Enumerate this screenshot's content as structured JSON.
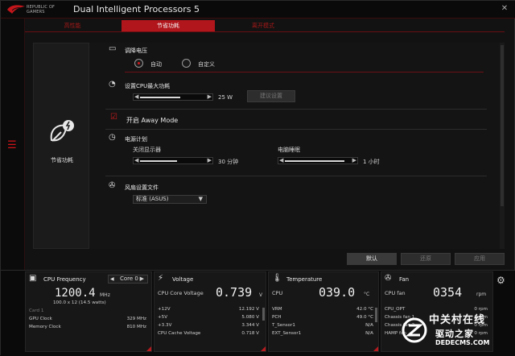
{
  "app": {
    "brand_line1": "REPUBLIC OF",
    "brand_line2": "GAMERS",
    "title": "Dual Intelligent Processors 5"
  },
  "window_controls": {
    "close": "✕"
  },
  "tabs": [
    {
      "label": "高性能"
    },
    {
      "label": "节省功耗",
      "active": true
    },
    {
      "label": "离开模式"
    }
  ],
  "function": {
    "label": "节省功耗",
    "icon": "leaf-power-icon"
  },
  "undervolt": {
    "title": "调降电压",
    "options": [
      "自动",
      "自定义"
    ],
    "selected": "自动"
  },
  "cpu_power": {
    "title": "设置CPU最大功耗",
    "value": "25 W",
    "button": "建议设置",
    "level": 0.62
  },
  "away_mode": {
    "label": "开启 Away Mode",
    "checked": true
  },
  "power_plan": {
    "title": "电源计划",
    "display_off": {
      "label": "关闭显示器",
      "value": "30 分钟",
      "level": 0.58
    },
    "sleep": {
      "label": "电脑睡眠",
      "value": "1 小时",
      "level": 0.92
    }
  },
  "fan_profile": {
    "title": "风扇设置文件",
    "selected": "标准 (ASUS)"
  },
  "actions": {
    "default": "默认",
    "undo": "还原",
    "apply": "应用"
  },
  "monitor": {
    "cpu_freq": {
      "title": "CPU Frequency",
      "core": "Core 0",
      "value": "1200.4",
      "unit": "MHz",
      "sub": "100.0 x 12 (14.5 watts)",
      "card": "Card 1",
      "rows": [
        {
          "k": "GPU Clock",
          "v": "329 MHz"
        },
        {
          "k": "Memory Clock",
          "v": "810 MHz"
        }
      ]
    },
    "voltage": {
      "title": "Voltage",
      "main_label": "CPU Core Voltage",
      "value": "0.739",
      "unit": "V",
      "rows": [
        {
          "k": "+12V",
          "v": "12.192 V"
        },
        {
          "k": "+5V",
          "v": "5.080 V"
        },
        {
          "k": "+3.3V",
          "v": "3.344 V"
        },
        {
          "k": "CPU Cache Voltage",
          "v": "0.718 V"
        }
      ]
    },
    "temperature": {
      "title": "Temperature",
      "main_label": "CPU",
      "value": "039.0",
      "unit": "°C",
      "rows": [
        {
          "k": "VRM",
          "v": "42.0 °C"
        },
        {
          "k": "PCH",
          "v": "49.0 °C"
        },
        {
          "k": "T_Sensor1",
          "v": "N/A"
        },
        {
          "k": "EXT_Sensor1",
          "v": "N/A"
        }
      ]
    },
    "fan": {
      "title": "Fan",
      "main_label": "CPU fan",
      "value": "0354",
      "unit": "rpm",
      "rows": [
        {
          "k": "CPU_OPT",
          "v": "0 rpm"
        },
        {
          "k": "Chassis fan 1",
          "v": "0 rpm"
        },
        {
          "k": "Chassis fan 2",
          "v": "0 rpm"
        },
        {
          "k": "HAMP fan",
          "v": "0 rpm"
        }
      ]
    }
  },
  "watermark": {
    "cn": "中关村在线",
    "cn2": "驱动之家",
    "url": "DEDECMS.COM"
  },
  "colors": {
    "accent": "#b1161c",
    "bg": "#121212"
  }
}
